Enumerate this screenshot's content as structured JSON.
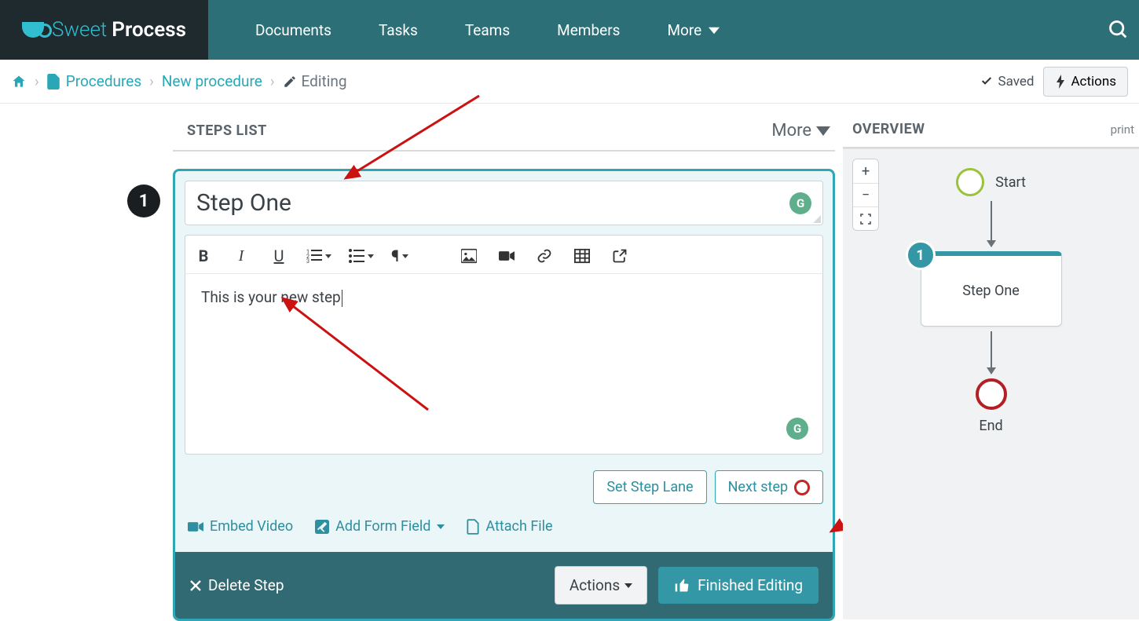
{
  "brand": {
    "a": "Sweet",
    "b": "Process"
  },
  "nav": {
    "documents": "Documents",
    "tasks": "Tasks",
    "teams": "Teams",
    "members": "Members",
    "more": "More"
  },
  "crumbs": {
    "procedures": "Procedures",
    "newproc": "New procedure",
    "editing": "Editing",
    "saved": "Saved",
    "actions": "Actions"
  },
  "stepslist": {
    "title": "STEPS LIST",
    "more": "More"
  },
  "step": {
    "number": "1",
    "title": "Step One",
    "body": "This is your new step",
    "set_lane": "Set Step Lane",
    "next_step": "Next step",
    "embed_video": "Embed Video",
    "add_form_field": "Add Form Field",
    "attach_file": "Attach File",
    "delete": "Delete Step",
    "actions": "Actions",
    "finished": "Finished Editing"
  },
  "overview": {
    "title": "OVERVIEW",
    "print": "print",
    "start": "Start",
    "step1_badge": "1",
    "step1_label": "Step One",
    "end": "End"
  }
}
